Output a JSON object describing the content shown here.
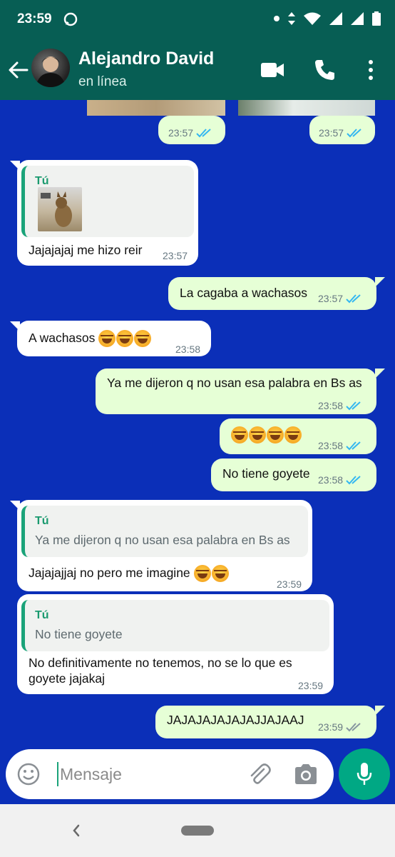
{
  "status_bar": {
    "time": "23:59"
  },
  "header": {
    "contact_name": "Alejandro David",
    "presence": "en línea"
  },
  "messages": [
    {
      "id": "m1",
      "side": "out",
      "time": "23:57",
      "read": true
    },
    {
      "id": "m2",
      "side": "out",
      "time": "23:57",
      "read": true
    },
    {
      "id": "m3",
      "side": "in",
      "quote_author": "Tú",
      "text": "Jajajajaj me hizo reir",
      "time": "23:57"
    },
    {
      "id": "m4",
      "side": "out",
      "text": "La cagaba a wachasos",
      "time": "23:57",
      "read": true
    },
    {
      "id": "m5",
      "side": "in",
      "text": "A wachasos",
      "emoji_count": 3,
      "time": "23:58"
    },
    {
      "id": "m6",
      "side": "out",
      "text": "Ya me dijeron q no usan esa palabra en Bs as",
      "time": "23:58",
      "read": true
    },
    {
      "id": "m7",
      "side": "out",
      "emoji_count": 4,
      "time": "23:58",
      "read": true
    },
    {
      "id": "m8",
      "side": "out",
      "text": "No tiene goyete",
      "time": "23:58",
      "read": true
    },
    {
      "id": "m9",
      "side": "in",
      "quote_author": "Tú",
      "quote_text": "Ya me dijeron q no usan esa palabra en Bs as",
      "text": "Jajajajjaj no pero me imagine",
      "emoji_count": 2,
      "time": "23:59"
    },
    {
      "id": "m10",
      "side": "in",
      "quote_author": "Tú",
      "quote_text": "No tiene goyete",
      "text_line1": "No definitivamente no tenemos, no se lo que es",
      "text_line2": "goyete jajakaj",
      "time": "23:59"
    },
    {
      "id": "m11",
      "side": "out",
      "text": "JAJAJAJAJAJAJJAJAAJ",
      "time": "23:59",
      "read": false
    }
  ],
  "composer": {
    "placeholder": "Mensaje"
  },
  "colors": {
    "header_bg": "#075e54",
    "chat_bg": "#0b2fb8",
    "outgoing_bubble": "#e6ffd6",
    "incoming_bubble": "#ffffff",
    "accent": "#00a884",
    "read_ticks": "#34b7f1",
    "unread_ticks": "#8696a0"
  },
  "icons": [
    "whatsapp-notification-icon",
    "dot-icon",
    "data-arrows-icon",
    "wifi-icon",
    "signal-icon",
    "signal-icon",
    "battery-icon",
    "back-arrow-icon",
    "video-call-icon",
    "phone-icon",
    "more-options-icon",
    "emoji-icon",
    "attach-icon",
    "camera-icon",
    "mic-icon",
    "nav-back-icon",
    "home-pill"
  ]
}
